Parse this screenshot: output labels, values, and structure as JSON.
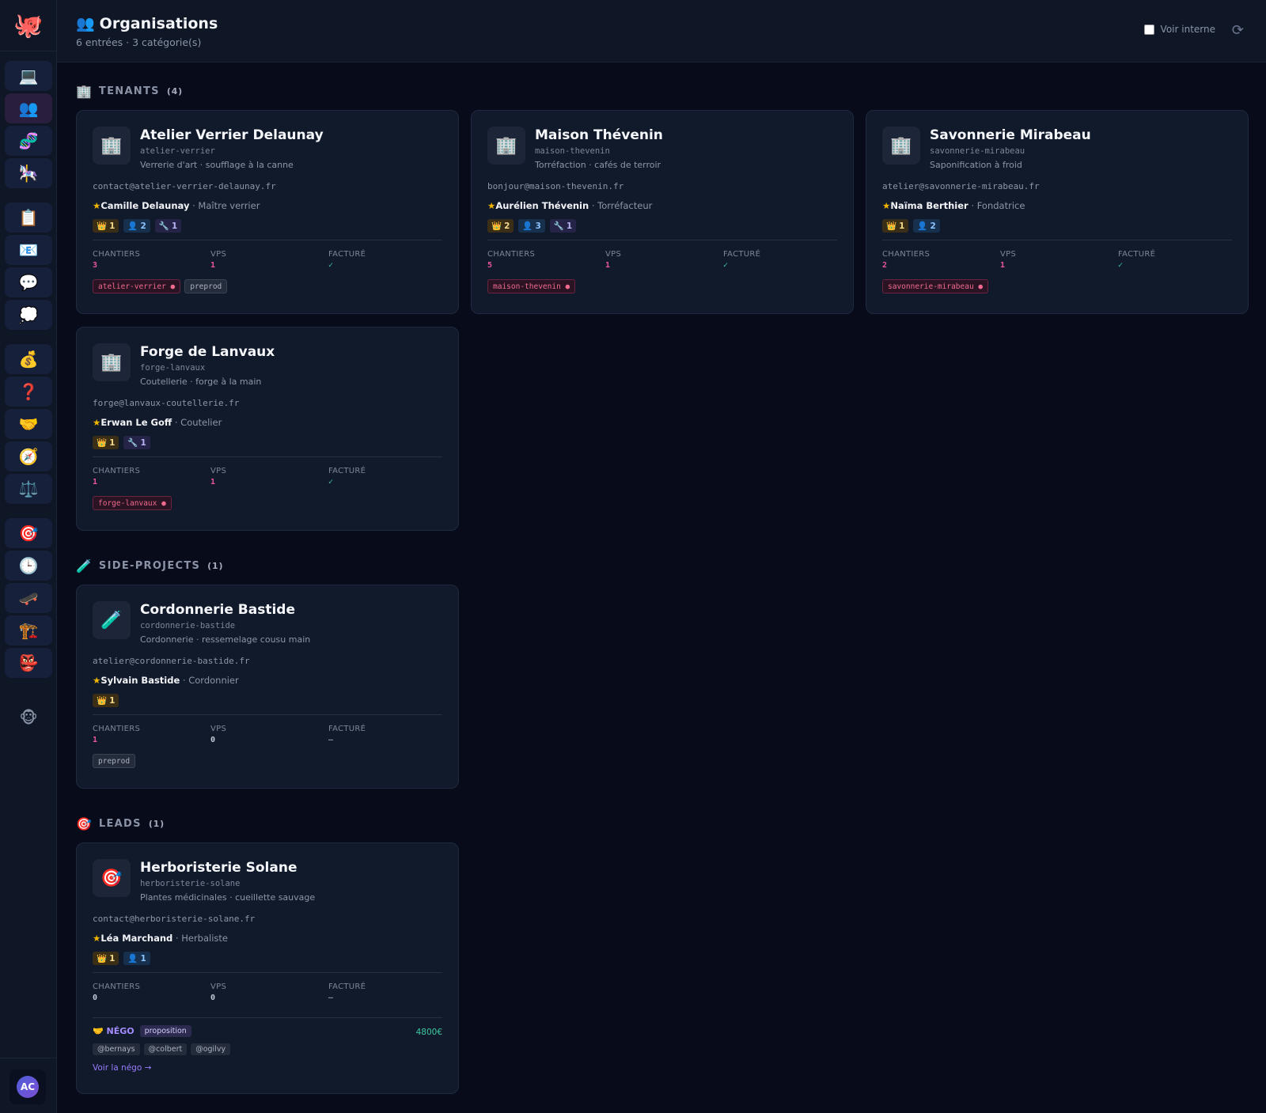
{
  "app": {
    "logo_icon": "🐙",
    "user_initials": "AC"
  },
  "sidebar": {
    "items": [
      {
        "name": "laptop",
        "icon": "💻"
      },
      {
        "name": "organisations",
        "icon": "👥"
      },
      {
        "name": "dna",
        "icon": "🧬"
      },
      {
        "name": "carousel",
        "icon": "🎠"
      },
      {
        "name": "clipboard",
        "icon": "📋"
      },
      {
        "name": "email",
        "icon": "📧"
      },
      {
        "name": "chat",
        "icon": "💬"
      },
      {
        "name": "thought",
        "icon": "💭"
      },
      {
        "name": "money",
        "icon": "💰"
      },
      {
        "name": "question",
        "icon": "❓"
      },
      {
        "name": "handshake",
        "icon": "🤝"
      },
      {
        "name": "compass",
        "icon": "🧭"
      },
      {
        "name": "scales",
        "icon": "⚖️"
      },
      {
        "name": "target",
        "icon": "🎯"
      },
      {
        "name": "clock",
        "icon": "🕒"
      },
      {
        "name": "skateboard",
        "icon": "🛹"
      },
      {
        "name": "construction",
        "icon": "🏗️"
      },
      {
        "name": "goblin",
        "icon": "👺"
      },
      {
        "name": "monkey",
        "icon": "🐵"
      }
    ]
  },
  "header": {
    "title_icon": "👥",
    "title": "Organisations",
    "subtitle": "6 entrées · 3 catégorie(s)",
    "internal_label": "Voir interne",
    "refresh_icon": "⟳"
  },
  "labels": {
    "chantiers": "CHANTIERS",
    "vps": "VPS",
    "facture": "FACTURÉ",
    "star": "★",
    "sep": " · ",
    "owner_icon": "👑",
    "member_icon": "👤",
    "tech_icon": "🔧"
  },
  "sections": {
    "tenants": {
      "icon": "🏢",
      "title": "TENANTS",
      "count": "(4)"
    },
    "side": {
      "icon": "🧪",
      "title": "SIDE-PROJECTS",
      "count": "(1)"
    },
    "leads": {
      "icon": "🎯",
      "title": "LEADS",
      "count": "(1)"
    }
  },
  "cards": {
    "delaunay": {
      "icon": "🏢",
      "name": "Atelier Verrier Delaunay",
      "slug": "atelier-verrier",
      "desc": "Verrerie d'art · soufflage à la canne",
      "email": "contact@atelier-verrier-delaunay.fr",
      "contact": "Camille Delaunay",
      "role": "Maître verrier",
      "owners": "1",
      "members": "2",
      "techs": "1",
      "chantiers": "3",
      "vps": "1",
      "facture": "✓",
      "tags": [
        "atelier-verrier ●",
        "preprod"
      ]
    },
    "thevenin": {
      "icon": "🏢",
      "name": "Maison Thévenin",
      "slug": "maison-thevenin",
      "desc": "Torréfaction · cafés de terroir",
      "email": "bonjour@maison-thevenin.fr",
      "contact": "Aurélien Thévenin",
      "role": "Torréfacteur",
      "owners": "2",
      "members": "3",
      "techs": "1",
      "chantiers": "5",
      "vps": "1",
      "facture": "✓",
      "tags": [
        "maison-thevenin ●"
      ]
    },
    "mirabeau": {
      "icon": "🏢",
      "name": "Savonnerie Mirabeau",
      "slug": "savonnerie-mirabeau",
      "desc": "Saponification à froid",
      "email": "atelier@savonnerie-mirabeau.fr",
      "contact": "Naïma Berthier",
      "role": "Fondatrice",
      "owners": "1",
      "members": "2",
      "chantiers": "2",
      "vps": "1",
      "facture": "✓",
      "tags": [
        "savonnerie-mirabeau ●"
      ]
    },
    "lanvaux": {
      "icon": "🏢",
      "name": "Forge de Lanvaux",
      "slug": "forge-lanvaux",
      "desc": "Coutellerie · forge à la main",
      "email": "forge@lanvaux-coutellerie.fr",
      "contact": "Erwan Le Goff",
      "role": "Coutelier",
      "owners": "1",
      "techs": "1",
      "chantiers": "1",
      "vps": "1",
      "facture": "✓",
      "tags": [
        "forge-lanvaux ●"
      ]
    },
    "bastide": {
      "icon": "🧪",
      "name": "Cordonnerie Bastide",
      "slug": "cordonnerie-bastide",
      "desc": "Cordonnerie · ressemelage cousu main",
      "email": "atelier@cordonnerie-bastide.fr",
      "contact": "Sylvain Bastide",
      "role": "Cordonnier",
      "owners": "1",
      "chantiers": "1",
      "vps": "0",
      "facture": "—",
      "tags": [
        "preprod"
      ]
    },
    "solane": {
      "icon": "🎯",
      "name": "Herboristerie Solane",
      "slug": "herboristerie-solane",
      "desc": "Plantes médicinales · cueillette sauvage",
      "email": "contact@herboristerie-solane.fr",
      "contact": "Léa Marchand",
      "role": "Herbaliste",
      "owners": "1",
      "members": "1",
      "chantiers": "0",
      "vps": "0",
      "facture": "—",
      "nego": {
        "icon": "🤝",
        "label": "NÉGO",
        "status": "proposition",
        "amount": "4800€",
        "agents": [
          "@bernays",
          "@colbert",
          "@ogilvy"
        ],
        "link": "Voir la négo →"
      }
    }
  }
}
